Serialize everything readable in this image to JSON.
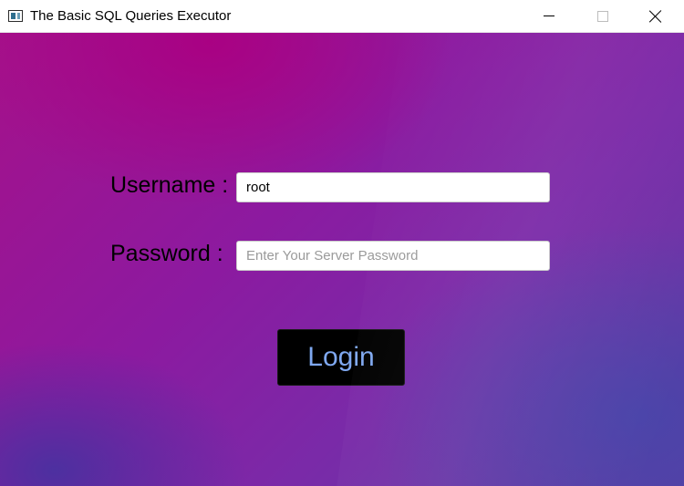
{
  "window": {
    "title": "The Basic SQL Queries Executor",
    "icon": "app-window-icon",
    "controls": {
      "minimize_icon": "minimize-icon",
      "maximize_icon": "maximize-icon",
      "close_icon": "close-icon"
    }
  },
  "form": {
    "username_label": "Username :",
    "username_value": "root",
    "password_label": "Password :",
    "password_value": "",
    "password_placeholder": "Enter Your Server Password",
    "login_label": "Login"
  },
  "colors": {
    "background_top": "#a5118a",
    "background_bottom": "#5c3fa4",
    "button_bg": "#000000",
    "button_text": "#7fa8f0"
  }
}
